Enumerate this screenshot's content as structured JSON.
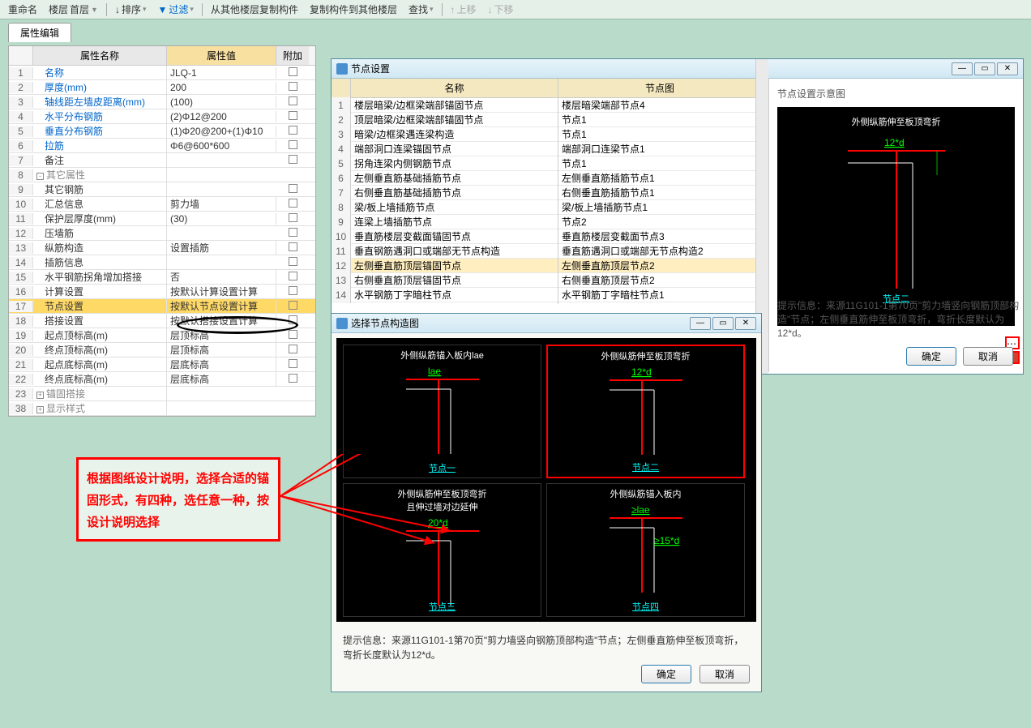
{
  "toolbar": {
    "rename": "重命名",
    "floor": "楼层",
    "floor_val": "首层",
    "sort": "排序",
    "filter": "过滤",
    "copy_from": "从其他楼层复制构件",
    "copy_to": "复制构件到其他楼层",
    "find": "查找",
    "move_up": "上移",
    "move_down": "下移"
  },
  "tabs": {
    "prop_edit": "属性编辑"
  },
  "prop_header": {
    "name": "属性名称",
    "value": "属性值",
    "extra": "附加"
  },
  "props": [
    {
      "n": "1",
      "name": "名称",
      "val": "JLQ-1",
      "blue": true
    },
    {
      "n": "2",
      "name": "厚度(mm)",
      "val": "200",
      "blue": true
    },
    {
      "n": "3",
      "name": "轴线距左墙皮距离(mm)",
      "val": "(100)",
      "blue": true
    },
    {
      "n": "4",
      "name": "水平分布钢筋",
      "val": "(2)Φ12@200",
      "blue": true
    },
    {
      "n": "5",
      "name": "垂直分布钢筋",
      "val": "(1)Φ20@200+(1)Φ10",
      "blue": true
    },
    {
      "n": "6",
      "name": "拉筋",
      "val": "Φ6@600*600",
      "blue": true
    },
    {
      "n": "7",
      "name": "备注",
      "val": ""
    },
    {
      "n": "8",
      "name": "其它属性",
      "val": "",
      "cat": true,
      "exp": "-"
    },
    {
      "n": "9",
      "name": "其它钢筋",
      "val": ""
    },
    {
      "n": "10",
      "name": "汇总信息",
      "val": "剪力墙"
    },
    {
      "n": "11",
      "name": "保护层厚度(mm)",
      "val": "(30)"
    },
    {
      "n": "12",
      "name": "压墙筋",
      "val": ""
    },
    {
      "n": "13",
      "name": "纵筋构造",
      "val": "设置插筋"
    },
    {
      "n": "14",
      "name": "插筋信息",
      "val": ""
    },
    {
      "n": "15",
      "name": "水平钢筋拐角增加搭接",
      "val": "否"
    },
    {
      "n": "16",
      "name": "计算设置",
      "val": "按默认计算设置计算"
    },
    {
      "n": "17",
      "name": "节点设置",
      "val": "按默认节点设置计算",
      "hl": true
    },
    {
      "n": "18",
      "name": "搭接设置",
      "val": "按默认搭接设置计算"
    },
    {
      "n": "19",
      "name": "起点顶标高(m)",
      "val": "层顶标高"
    },
    {
      "n": "20",
      "name": "终点顶标高(m)",
      "val": "层顶标高"
    },
    {
      "n": "21",
      "name": "起点底标高(m)",
      "val": "层底标高"
    },
    {
      "n": "22",
      "name": "终点底标高(m)",
      "val": "层底标高"
    },
    {
      "n": "23",
      "name": "锚固搭接",
      "val": "",
      "cat": true,
      "exp": "+"
    },
    {
      "n": "38",
      "name": "显示样式",
      "val": "",
      "cat": true,
      "exp": "+"
    }
  ],
  "node_dialog": {
    "title": "节点设置",
    "hdr_name": "名称",
    "hdr_img": "节点图",
    "preview_title": "节点设置示意图",
    "preview_caption": "外侧纵筋伸至板顶弯折",
    "preview_dim": "12*d",
    "preview_link": "节点二",
    "hint_label": "提示信息：",
    "hint_text": "来源11G101-1第70页\"剪力墙竖向钢筋顶部构造\"节点；左侧垂直筋伸至板顶弯折，弯折长度默认为12*d。",
    "ok": "确定",
    "cancel": "取消",
    "rows": [
      {
        "n": "1",
        "name": "楼层暗梁/边框梁端部锚固节点",
        "img": "楼层暗梁端部节点4"
      },
      {
        "n": "2",
        "name": "顶层暗梁/边框梁端部锚固节点",
        "img": "节点1"
      },
      {
        "n": "3",
        "name": "暗梁/边框梁遇连梁构造",
        "img": "节点1"
      },
      {
        "n": "4",
        "name": "端部洞口连梁锚固节点",
        "img": "端部洞口连梁节点1"
      },
      {
        "n": "5",
        "name": "拐角连梁内侧钢筋节点",
        "img": "节点1"
      },
      {
        "n": "6",
        "name": "左侧垂直筋基础插筋节点",
        "img": "左侧垂直筋插筋节点1"
      },
      {
        "n": "7",
        "name": "右侧垂直筋基础插筋节点",
        "img": "右侧垂直筋插筋节点1"
      },
      {
        "n": "8",
        "name": "梁/板上墙插筋节点",
        "img": "梁/板上墙插筋节点1"
      },
      {
        "n": "9",
        "name": "连梁上墙插筋节点",
        "img": "节点2"
      },
      {
        "n": "10",
        "name": "垂直筋楼层变截面锚固节点",
        "img": "垂直筋楼层变截面节点3"
      },
      {
        "n": "11",
        "name": "垂直钢筋遇洞口或端部无节点构造",
        "img": "垂直筋遇洞口或端部无节点构造2"
      },
      {
        "n": "12",
        "name": "左侧垂直筋顶层锚固节点",
        "img": "左侧垂直筋顶层节点2",
        "active": true
      },
      {
        "n": "13",
        "name": "右侧垂直筋顶层锚固节点",
        "img": "右侧垂直筋顶层节点2"
      },
      {
        "n": "14",
        "name": "水平钢筋丁字暗柱节点",
        "img": "水平钢筋丁字暗柱节点1"
      }
    ]
  },
  "sel_dialog": {
    "title": "选择节点构造图",
    "hint_label": "提示信息：",
    "hint_text": "来源11G101-1第70页\"剪力墙竖向钢筋顶部构造\"节点；左侧垂直筋伸至板顶弯折，弯折长度默认为12*d。",
    "ok": "确定",
    "cancel": "取消",
    "opts": [
      {
        "title": "外侧纵筋锚入板内lae",
        "sub": "lae",
        "link": "节点一"
      },
      {
        "title": "外侧纵筋伸至板顶弯折",
        "sub": "12*d",
        "link": "节点二",
        "sel": true
      },
      {
        "title": "外侧纵筋伸至板顶弯折\n且伸过墙对边延伸",
        "sub": "20*d",
        "link": "节点三"
      },
      {
        "title": "外侧纵筋锚入板内",
        "sub": "≥lae",
        "sub2": "≥15*d",
        "link": "节点四"
      }
    ]
  },
  "callout": "根据图纸设计说明，选择合适的锚固形式，有四种，选任意一种，按设计说明选择"
}
